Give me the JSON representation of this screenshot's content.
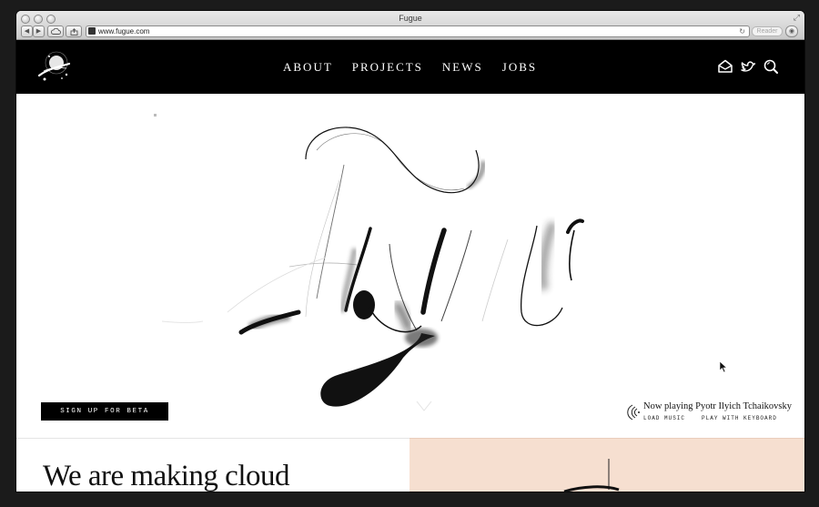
{
  "window": {
    "title": "Fugue"
  },
  "toolbar": {
    "url": "www.fugue.com",
    "reader_label": "Reader",
    "back_glyph": "◀",
    "forward_glyph": "▶",
    "reload_glyph": "↻"
  },
  "nav": {
    "items": [
      {
        "label": "ABOUT"
      },
      {
        "label": "PROJECTS"
      },
      {
        "label": "NEWS"
      },
      {
        "label": "JOBS"
      }
    ]
  },
  "header_icons": [
    "mail-icon",
    "twitter-icon",
    "search-icon"
  ],
  "hero": {
    "signup_label": "SIGN UP FOR BETA",
    "now_playing": "Now playing Pyotr Ilyich Tchaikovsky",
    "load_music_label": "LOAD MUSIC",
    "keyboard_label": "PLAY WITH KEYBOARD"
  },
  "bottom": {
    "headline": "We  are making cloud"
  },
  "colors": {
    "header_bg": "#000000",
    "panel_peach": "#f6dfd0",
    "ink": "#111111"
  }
}
